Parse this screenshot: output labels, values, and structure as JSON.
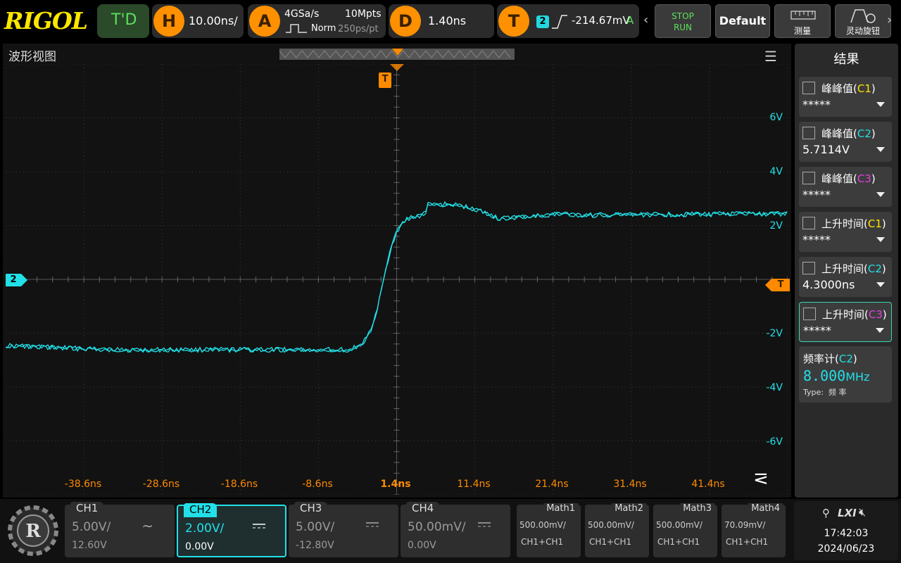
{
  "brand": "RIGOL",
  "topbar": {
    "td_label": "T'D",
    "h_letter": "H",
    "timebase": "10.00ns/",
    "a_letter": "A",
    "sample_rate": "4GSa/s",
    "mem_depth": "10Mpts",
    "acq_mode": "Norm",
    "sample_interval": "250ps/pt",
    "d_letter": "D",
    "delay": "1.40ns",
    "t_letter": "T",
    "trig_channel": "2",
    "trig_level": "-214.67mV",
    "trig_mode": "A",
    "stop_label": "STOP",
    "run_label": "RUN",
    "default_label": "Default",
    "measure_label": "测量",
    "knob_label": "灵动旋钮"
  },
  "waveform": {
    "title": "波形视图",
    "trigger_marker": "T",
    "channel_marker": "2",
    "volt_labels": [
      "6V",
      "4V",
      "2V",
      "-2V",
      "-4V",
      "-6V"
    ],
    "time_labels": [
      "-38.6ns",
      "-28.6ns",
      "-18.6ns",
      "-8.6ns",
      "1.4ns",
      "11.4ns",
      "21.4ns",
      "31.4ns",
      "41.4ns"
    ],
    "trace_color": "#22e0e8",
    "time_color": "#ff8a00"
  },
  "results": {
    "title": "结果",
    "items": [
      {
        "name": "峰峰值",
        "ch": "C1",
        "value": "*****"
      },
      {
        "name": "峰峰值",
        "ch": "C2",
        "value": "5.7114V"
      },
      {
        "name": "峰峰值",
        "ch": "C3",
        "value": "*****"
      },
      {
        "name": "上升时间",
        "ch": "C1",
        "value": "*****"
      },
      {
        "name": "上升时间",
        "ch": "C2",
        "value": "4.3000ns"
      },
      {
        "name": "上升时间",
        "ch": "C3",
        "value": "*****"
      }
    ],
    "freq": {
      "name": "频率计",
      "ch": "C2",
      "value": "8.000",
      "unit": "MHz",
      "type_label": "Type:",
      "type_value": "频 率"
    }
  },
  "channels": [
    {
      "name": "CH1",
      "scale": "5.00V/",
      "offset": "12.60V",
      "coupling": "~"
    },
    {
      "name": "CH2",
      "scale": "2.00V/",
      "offset": "0.00V",
      "coupling": "DC"
    },
    {
      "name": "CH3",
      "scale": "5.00V/",
      "offset": "-12.80V",
      "coupling": "DC"
    },
    {
      "name": "CH4",
      "scale": "50.00mV/",
      "offset": "0.00V",
      "coupling": "DC"
    }
  ],
  "math": [
    {
      "name": "Math1",
      "scale": "500.00mV/",
      "expr": "CH1+CH1"
    },
    {
      "name": "Math2",
      "scale": "500.00mV/",
      "expr": "CH1+CH1"
    },
    {
      "name": "Math3",
      "scale": "500.00mV/",
      "expr": "CH1+CH1"
    },
    {
      "name": "Math4",
      "scale": "70.09mV/",
      "expr": "CH1+CH1"
    }
  ],
  "status": {
    "lxi": "LXI",
    "time": "17:42:03",
    "date": "2024/06/23"
  }
}
